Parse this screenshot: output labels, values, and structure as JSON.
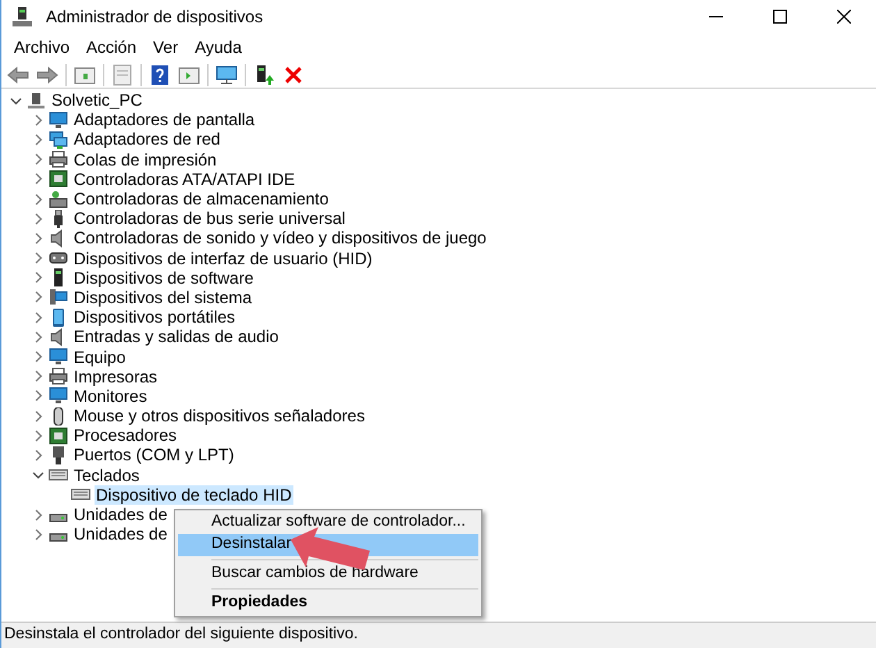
{
  "window": {
    "title": "Administrador de dispositivos"
  },
  "menu_bar": [
    "Archivo",
    "Acción",
    "Ver",
    "Ayuda"
  ],
  "tree": {
    "label": "Solvetic_PC",
    "expanded": true,
    "selected": false,
    "children": [
      {
        "label": "Adaptadores de pantalla",
        "expanded": false,
        "selected": false
      },
      {
        "label": "Adaptadores de red",
        "expanded": false,
        "selected": false
      },
      {
        "label": "Colas de impresión",
        "expanded": false,
        "selected": false
      },
      {
        "label": "Controladoras ATA/ATAPI IDE",
        "expanded": false,
        "selected": false
      },
      {
        "label": "Controladoras de almacenamiento",
        "expanded": false,
        "selected": false
      },
      {
        "label": "Controladoras de bus serie universal",
        "expanded": false,
        "selected": false
      },
      {
        "label": "Controladoras de sonido y vídeo y dispositivos de juego",
        "expanded": false,
        "selected": false
      },
      {
        "label": "Dispositivos de interfaz de usuario (HID)",
        "expanded": false,
        "selected": false
      },
      {
        "label": "Dispositivos de software",
        "expanded": false,
        "selected": false
      },
      {
        "label": "Dispositivos del sistema",
        "expanded": false,
        "selected": false
      },
      {
        "label": "Dispositivos portátiles",
        "expanded": false,
        "selected": false
      },
      {
        "label": "Entradas y salidas de audio",
        "expanded": false,
        "selected": false
      },
      {
        "label": "Equipo",
        "expanded": false,
        "selected": false
      },
      {
        "label": "Impresoras",
        "expanded": false,
        "selected": false
      },
      {
        "label": "Monitores",
        "expanded": false,
        "selected": false
      },
      {
        "label": "Mouse y otros dispositivos señaladores",
        "expanded": false,
        "selected": false
      },
      {
        "label": "Procesadores",
        "expanded": false,
        "selected": false
      },
      {
        "label": "Puertos (COM y LPT)",
        "expanded": false,
        "selected": false
      },
      {
        "label": "Teclados",
        "expanded": true,
        "selected": false,
        "children": [
          {
            "label": "Dispositivo de teclado HID",
            "selected": true
          }
        ]
      },
      {
        "label": "Unidades de",
        "expanded": false,
        "selected": false
      },
      {
        "label": "Unidades de",
        "expanded": false,
        "selected": false
      }
    ]
  },
  "context_menu": [
    {
      "label": "Actualizar software de controlador...",
      "selected": false,
      "bold": false,
      "separator_before": false
    },
    {
      "label": "Desinstalar",
      "selected": true,
      "bold": false,
      "separator_before": false
    },
    {
      "label": "Buscar cambios de hardware",
      "selected": false,
      "bold": false,
      "separator_before": true
    },
    {
      "label": "Propiedades",
      "selected": false,
      "bold": true,
      "separator_before": true
    }
  ],
  "status_bar": "Desinstala el controlador del siguiente dispositivo."
}
